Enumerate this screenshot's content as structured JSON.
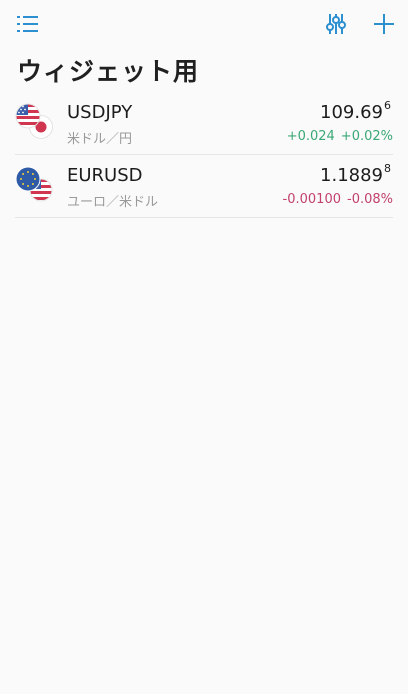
{
  "header": {
    "title": "ウィジェット用",
    "menu_icon": "list-menu-icon",
    "filter_icon": "sliders-icon",
    "add_icon": "plus-icon"
  },
  "colors": {
    "accent": "#2b8fd0",
    "positive": "#3aa876",
    "negative": "#c2416e"
  },
  "quotes": [
    {
      "symbol": "USDJPY",
      "description": "米ドル／円",
      "price_main": "109.69",
      "price_pip": "6",
      "change": "+0.024",
      "change_percent": "+0.02%",
      "direction": "up",
      "base_flag": "us-flag-icon",
      "quote_flag": "japan-flag-icon"
    },
    {
      "symbol": "EURUSD",
      "description": "ユーロ／米ドル",
      "price_main": "1.1889",
      "price_pip": "8",
      "change": "-0.00100",
      "change_percent": "-0.08%",
      "direction": "down",
      "base_flag": "eu-flag-icon",
      "quote_flag": "us-flag-icon"
    }
  ]
}
